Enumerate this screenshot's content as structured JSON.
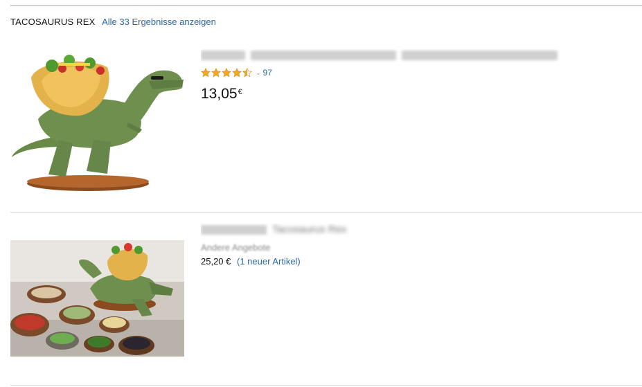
{
  "header": {
    "brand": "TACOSAURUS REX",
    "all_results_link": "Alle 33 Ergebnisse anzeigen"
  },
  "products": [
    {
      "title": "",
      "rating": {
        "stars": 4.5,
        "count": "97"
      },
      "price_whole": "13,05",
      "price_currency": "€",
      "image_icon": "dinosaur-taco-holder-image"
    },
    {
      "title_visible_part": "Tacosaurus Rex",
      "offers_label": "Andere Angebote",
      "price": "25,20 €",
      "new_items": "(1 neuer Artikel)",
      "image_icon": "dinosaur-taco-holder-with-bowls-image"
    }
  ],
  "colors": {
    "link": "#2a67a8",
    "star": "#f5a623",
    "dino_green": "#6f8f4e"
  }
}
